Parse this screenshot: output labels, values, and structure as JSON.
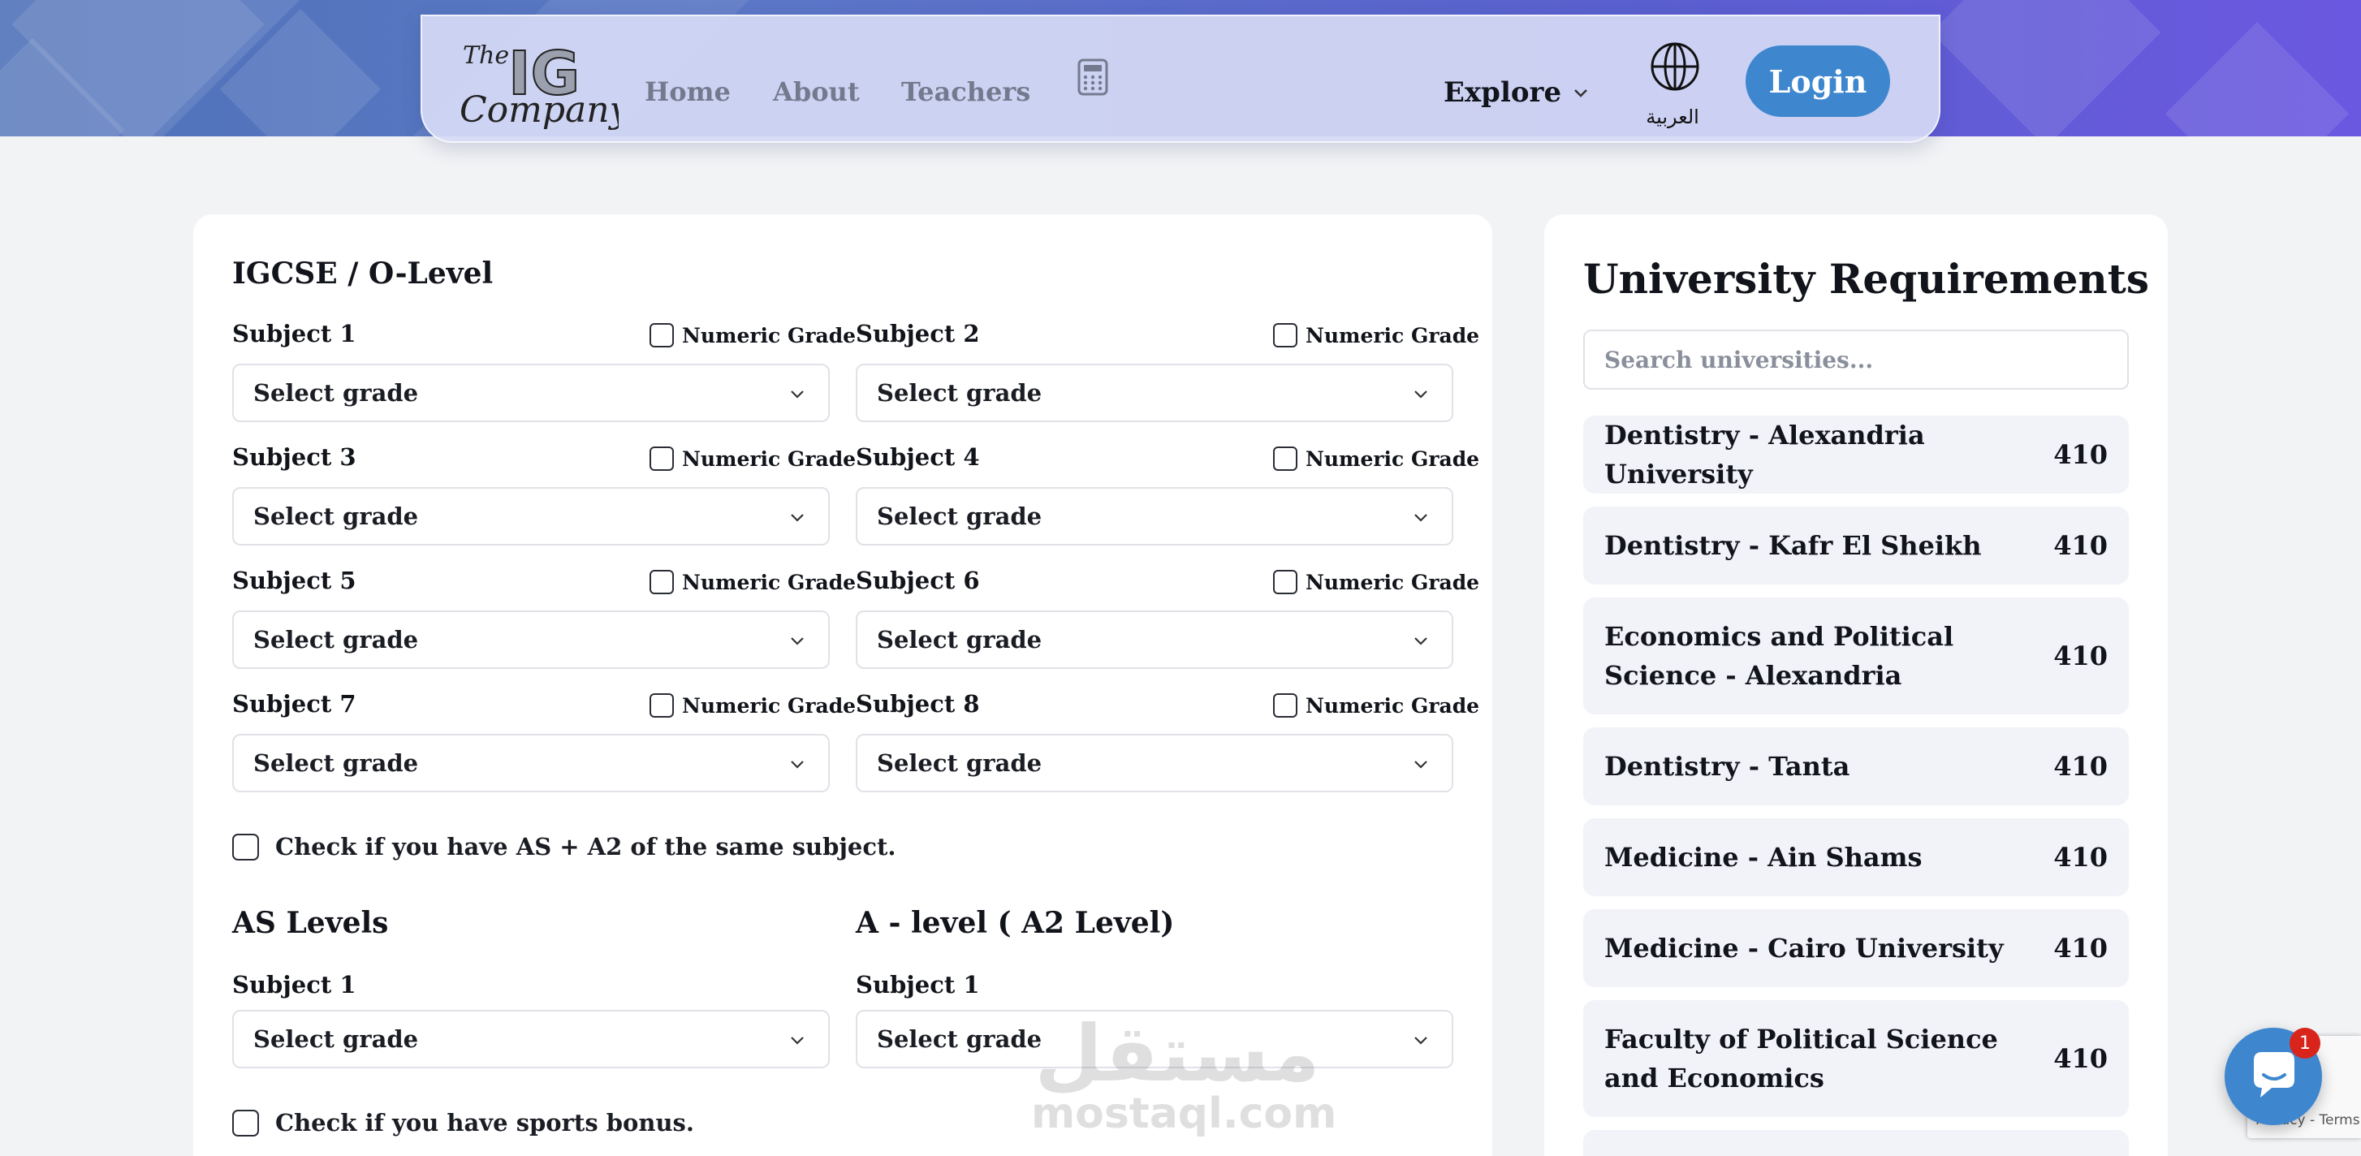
{
  "nav": {
    "logo_line1": "The",
    "logo_mark": "IG",
    "logo_line2": "Company",
    "links": [
      "Home",
      "About",
      "Teachers"
    ],
    "calculator_icon": "calculator-icon",
    "explore_label": "Explore",
    "language_label": "العربية",
    "language_icon": "globe-icon",
    "login_label": "Login",
    "accent_color": "#3e87cf"
  },
  "igcse": {
    "title": "IGCSE / O-Level",
    "numeric_label": "Numeric Grade",
    "placeholder": "Select grade",
    "subjects": [
      "Subject 1",
      "Subject 2",
      "Subject 3",
      "Subject 4",
      "Subject 5",
      "Subject 6",
      "Subject 7",
      "Subject 8"
    ]
  },
  "same_subject_check": "Check if you have AS + A2 of the same subject.",
  "as_levels": {
    "title": "AS Levels",
    "subject": "Subject 1",
    "placeholder": "Select grade"
  },
  "a_levels": {
    "title": "A - level ( A2 Level)",
    "subject": "Subject 1",
    "placeholder": "Select grade"
  },
  "sports_check": "Check if you have sports bonus.",
  "watermark": {
    "arabic": "مستقل",
    "latin": "mostaql.com"
  },
  "requirements": {
    "title": "University Requirements",
    "search_placeholder": "Search universities...",
    "items": [
      {
        "name": "Dentistry - Alexandria University",
        "score": "410"
      },
      {
        "name": "Dentistry - Kafr El Sheikh",
        "score": "410"
      },
      {
        "name": "Economics and Political Science - Alexandria",
        "score": "410"
      },
      {
        "name": "Dentistry - Tanta",
        "score": "410"
      },
      {
        "name": "Medicine - Ain Shams",
        "score": "410"
      },
      {
        "name": "Medicine - Cairo University",
        "score": "410"
      },
      {
        "name": "Faculty of Political Science and Economics",
        "score": "410"
      }
    ]
  },
  "chat": {
    "badge": "1",
    "icon": "chat-bubble-icon"
  },
  "recaptcha": {
    "text": "Privacy - Terms"
  }
}
